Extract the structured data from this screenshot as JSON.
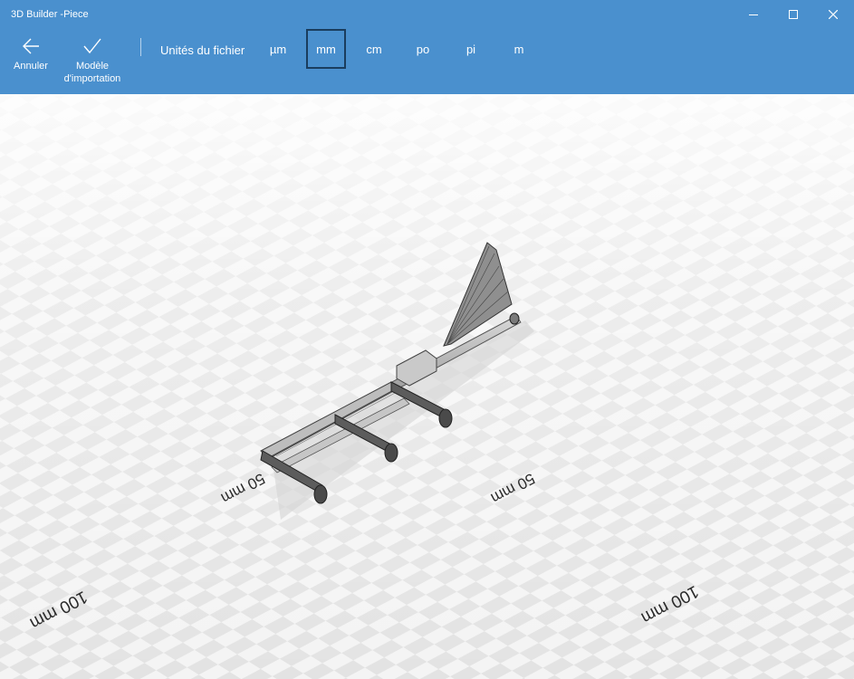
{
  "window": {
    "title": "3D Builder -Piece",
    "controls": {
      "minimize": "minimize-icon",
      "maximize": "maximize-icon",
      "close": "close-icon"
    }
  },
  "toolbar": {
    "cancel_label": "Annuler",
    "import_label_line1": "Modèle",
    "import_label_line2": "d'importation",
    "units_label": "Unités du fichier",
    "units": [
      "µm",
      "mm",
      "cm",
      "po",
      "pi",
      "m"
    ],
    "selected_unit": "mm"
  },
  "viewport": {
    "scale_labels": {
      "left_near": "50 mm",
      "right_near": "50 mm",
      "left_far": "100 mm",
      "right_far": "100 mm"
    }
  },
  "colors": {
    "accent": "#4a90ce",
    "selected_border": "#1a3d5e",
    "floor_light": "#f4f4f4",
    "floor_dark": "#e2e2e2"
  }
}
